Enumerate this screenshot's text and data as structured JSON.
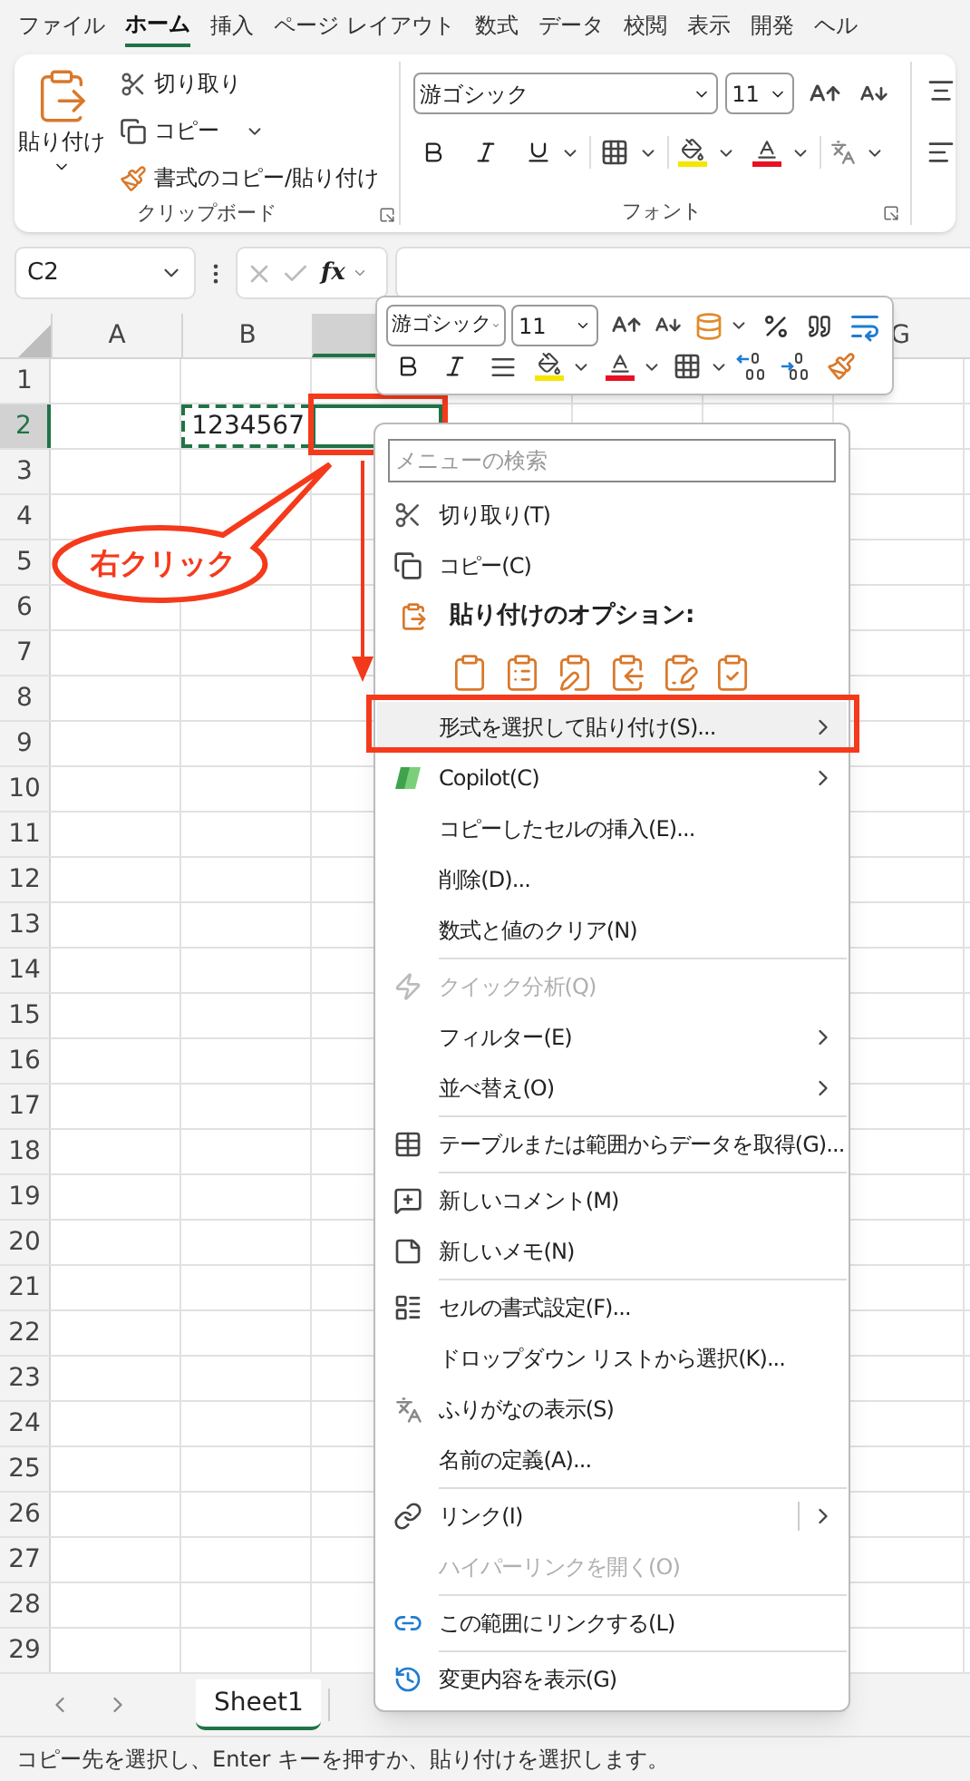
{
  "ribbon_tabs": [
    {
      "label": "ファイル",
      "selected": false
    },
    {
      "label": "ホーム",
      "selected": true
    },
    {
      "label": "挿入",
      "selected": false
    },
    {
      "label": "ページ レイアウト",
      "selected": false
    },
    {
      "label": "数式",
      "selected": false
    },
    {
      "label": "データ",
      "selected": false
    },
    {
      "label": "校閲",
      "selected": false
    },
    {
      "label": "表示",
      "selected": false
    },
    {
      "label": "開発",
      "selected": false
    },
    {
      "label": "ヘル",
      "selected": false
    }
  ],
  "clipboard_group": {
    "paste": "貼り付け",
    "cut": "切り取り",
    "copy": "コピー",
    "format_painter": "書式のコピー/貼り付け",
    "label": "クリップボード"
  },
  "font_group": {
    "font_name": "游ゴシック",
    "font_size": "11",
    "label": "フォント"
  },
  "formula_bar": {
    "name_box": "C2",
    "function_label": "fx"
  },
  "columns": [
    {
      "label": "A",
      "selected": false
    },
    {
      "label": "B",
      "selected": false
    },
    {
      "selected": true
    },
    {
      "label": "G",
      "selected": false
    }
  ],
  "rows": [
    {
      "label": "1",
      "selected": false
    },
    {
      "label": "2",
      "selected": true
    },
    {
      "label": "3",
      "selected": false
    },
    {
      "label": "4",
      "selected": false
    },
    {
      "label": "5",
      "selected": false
    },
    {
      "label": "6",
      "selected": false
    },
    {
      "label": "7",
      "selected": false
    },
    {
      "label": "8",
      "selected": false
    },
    {
      "label": "9",
      "selected": false
    },
    {
      "label": "10",
      "selected": false
    },
    {
      "label": "11",
      "selected": false
    },
    {
      "label": "12",
      "selected": false
    },
    {
      "label": "13",
      "selected": false
    },
    {
      "label": "14",
      "selected": false
    },
    {
      "label": "15",
      "selected": false
    },
    {
      "label": "16",
      "selected": false
    },
    {
      "label": "17",
      "selected": false
    },
    {
      "label": "18",
      "selected": false
    },
    {
      "label": "19",
      "selected": false
    },
    {
      "label": "20",
      "selected": false
    },
    {
      "label": "21",
      "selected": false
    },
    {
      "label": "22",
      "selected": false
    },
    {
      "label": "23",
      "selected": false
    },
    {
      "label": "24",
      "selected": false
    },
    {
      "label": "25",
      "selected": false
    },
    {
      "label": "26",
      "selected": false
    },
    {
      "label": "27",
      "selected": false
    },
    {
      "label": "28",
      "selected": false
    },
    {
      "label": "29",
      "selected": false
    }
  ],
  "copied_cell": {
    "value": "1234567"
  },
  "mini_toolbar": {
    "font_name": "游ゴシック",
    "font_size": "11"
  },
  "context_menu": {
    "search": {
      "placeholder": "メニューの検索"
    },
    "items": [
      {
        "kind": "item",
        "label": "切り取り(T)",
        "disabled": false,
        "submenu": false,
        "selected": false
      },
      {
        "kind": "item",
        "label": "コピー(C)",
        "disabled": false,
        "submenu": false,
        "selected": false
      },
      {
        "kind": "heading",
        "label": "貼り付けのオプション:"
      },
      {
        "kind": "paste-options"
      },
      {
        "kind": "item",
        "label": "形式を選択して貼り付け(S)...",
        "disabled": false,
        "submenu": true,
        "selected": true
      },
      {
        "kind": "item",
        "label": "Copilot(C)",
        "disabled": false,
        "submenu": true,
        "selected": false
      },
      {
        "kind": "item",
        "label": "コピーしたセルの挿入(E)...",
        "disabled": false,
        "submenu": false,
        "selected": false
      },
      {
        "kind": "item",
        "label": "削除(D)...",
        "disabled": false,
        "submenu": false,
        "selected": false
      },
      {
        "kind": "item",
        "label": "数式と値のクリア(N)",
        "disabled": false,
        "submenu": false,
        "selected": false
      },
      {
        "kind": "separator"
      },
      {
        "kind": "item",
        "label": "クイック分析(Q)",
        "disabled": true,
        "submenu": false,
        "selected": false
      },
      {
        "kind": "item",
        "label": "フィルター(E)",
        "disabled": false,
        "submenu": true,
        "selected": false
      },
      {
        "kind": "item",
        "label": "並べ替え(O)",
        "disabled": false,
        "submenu": true,
        "selected": false
      },
      {
        "kind": "separator"
      },
      {
        "kind": "item",
        "label": "テーブルまたは範囲からデータを取得(G)...",
        "disabled": false,
        "submenu": false,
        "selected": false
      },
      {
        "kind": "separator"
      },
      {
        "kind": "item",
        "label": "新しいコメント(M)",
        "disabled": false,
        "submenu": false,
        "selected": false
      },
      {
        "kind": "item",
        "label": "新しいメモ(N)",
        "disabled": false,
        "submenu": false,
        "selected": false
      },
      {
        "kind": "separator"
      },
      {
        "kind": "item",
        "label": "セルの書式設定(F)...",
        "disabled": false,
        "submenu": false,
        "selected": false
      },
      {
        "kind": "item",
        "label": "ドロップダウン リストから選択(K)...",
        "disabled": false,
        "submenu": false,
        "selected": false
      },
      {
        "kind": "item",
        "label": "ふりがなの表示(S)",
        "disabled": false,
        "submenu": false,
        "selected": false
      },
      {
        "kind": "item",
        "label": "名前の定義(A)...",
        "disabled": false,
        "submenu": false,
        "selected": false
      },
      {
        "kind": "separator"
      },
      {
        "kind": "item",
        "label": "リンク(I)",
        "disabled": false,
        "submenu": true,
        "selected": false
      },
      {
        "kind": "item",
        "label": "ハイパーリンクを開く(O)",
        "disabled": true,
        "submenu": false,
        "selected": false
      },
      {
        "kind": "separator"
      },
      {
        "kind": "item",
        "label": "この範囲にリンクする(L)",
        "disabled": false,
        "submenu": false,
        "selected": false
      },
      {
        "kind": "separator"
      },
      {
        "kind": "item",
        "label": "変更内容を表示(G)",
        "disabled": false,
        "submenu": false,
        "selected": false
      }
    ]
  },
  "annotation": {
    "callout": "右クリック"
  },
  "sheet_tabs": [
    {
      "label": "Sheet1",
      "selected": true
    }
  ],
  "status_bar": "コピー先を選択し、Enter キーを押すか、貼り付けを選択します。"
}
